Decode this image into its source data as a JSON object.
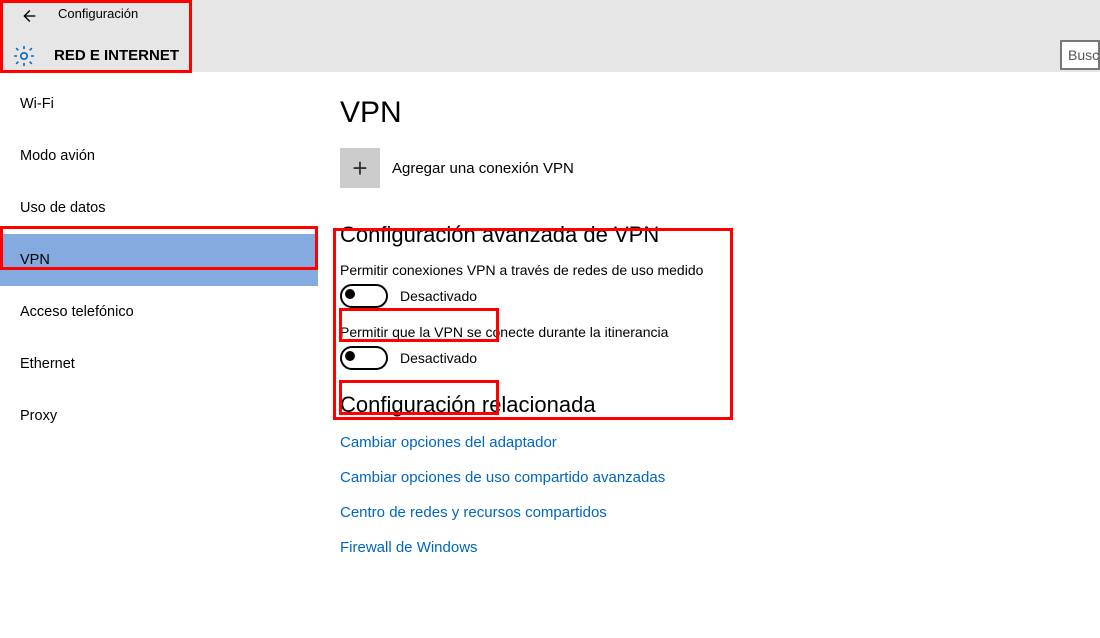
{
  "header": {
    "title": "Configuración",
    "section": "RED E INTERNET",
    "search_placeholder": "Busca"
  },
  "sidebar": {
    "items": [
      {
        "label": "Wi-Fi",
        "selected": false
      },
      {
        "label": "Modo avión",
        "selected": false
      },
      {
        "label": "Uso de datos",
        "selected": false
      },
      {
        "label": "VPN",
        "selected": true
      },
      {
        "label": "Acceso telefónico",
        "selected": false
      },
      {
        "label": "Ethernet",
        "selected": false
      },
      {
        "label": "Proxy",
        "selected": false
      }
    ]
  },
  "main": {
    "page_title": "VPN",
    "add_connection_label": "Agregar una conexión VPN",
    "advanced_heading": "Configuración avanzada de VPN",
    "option1_label": "Permitir conexiones VPN a través de redes de uso medido",
    "option1_state": "Desactivado",
    "option2_label": "Permitir que la VPN se conecte durante la itinerancia",
    "option2_state": "Desactivado",
    "related_heading": "Configuración relacionada",
    "related_links": [
      "Cambiar opciones del adaptador",
      "Cambiar opciones de uso compartido avanzadas",
      "Centro de redes y recursos compartidos",
      "Firewall de Windows"
    ]
  }
}
